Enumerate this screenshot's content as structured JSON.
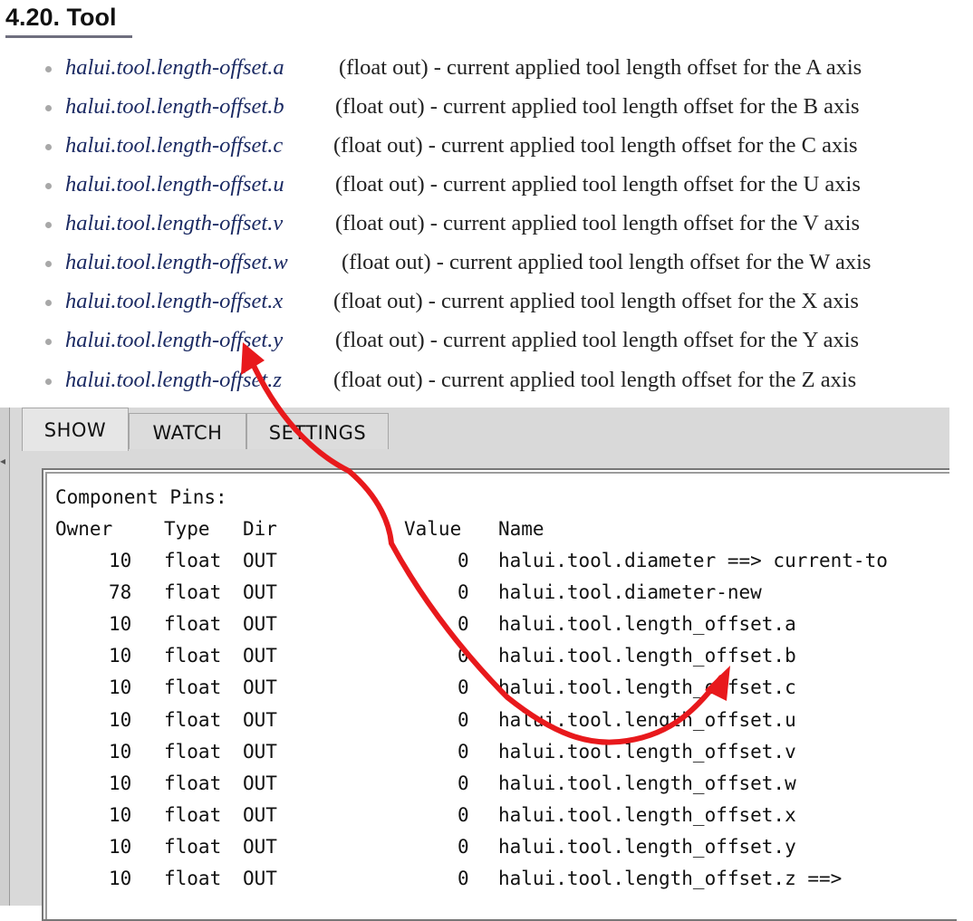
{
  "doc": {
    "title": "4.20. Tool",
    "pins": [
      {
        "name": "halui.tool.length-offset.a",
        "desc": "(float out) - current applied tool length offset for the A axis"
      },
      {
        "name": "halui.tool.length-offset.b",
        "desc": "(float out) - current applied tool length offset for the B axis"
      },
      {
        "name": "halui.tool.length-offset.c",
        "desc": "(float out) - current applied tool length offset for the C axis"
      },
      {
        "name": "halui.tool.length-offset.u",
        "desc": "(float out) - current applied tool length offset for the U axis"
      },
      {
        "name": "halui.tool.length-offset.v",
        "desc": "(float out) - current applied tool length offset for the V axis"
      },
      {
        "name": "halui.tool.length-offset.w",
        "desc": "(float out) - current applied tool length offset for the W axis"
      },
      {
        "name": "halui.tool.length-offset.x",
        "desc": "(float out) - current applied tool length offset for the X axis"
      },
      {
        "name": "halui.tool.length-offset.y",
        "desc": "(float out) - current applied tool length offset for the Y axis"
      },
      {
        "name": "halui.tool.length-offset.z",
        "desc": "(float out) - current applied tool length offset for the Z axis"
      }
    ]
  },
  "halshow": {
    "tabs": [
      {
        "label": "SHOW",
        "active": true
      },
      {
        "label": "WATCH",
        "active": false
      },
      {
        "label": "SETTINGS",
        "active": false
      }
    ],
    "section_title": "Component Pins:",
    "columns": {
      "owner": "Owner",
      "type": "Type",
      "dir": "Dir",
      "value": "Value",
      "name": "Name"
    },
    "rows": [
      {
        "owner": "10",
        "type": "float",
        "dir": "OUT",
        "value": "0",
        "name": "halui.tool.diameter ==> current-to"
      },
      {
        "owner": "78",
        "type": "float",
        "dir": "OUT",
        "value": "0",
        "name": "halui.tool.diameter-new"
      },
      {
        "owner": "10",
        "type": "float",
        "dir": "OUT",
        "value": "0",
        "name": "halui.tool.length_offset.a"
      },
      {
        "owner": "10",
        "type": "float",
        "dir": "OUT",
        "value": "0",
        "name": "halui.tool.length_offset.b"
      },
      {
        "owner": "10",
        "type": "float",
        "dir": "OUT",
        "value": "0",
        "name": "halui.tool.length_offset.c"
      },
      {
        "owner": "10",
        "type": "float",
        "dir": "OUT",
        "value": "0",
        "name": "halui.tool.length_offset.u"
      },
      {
        "owner": "10",
        "type": "float",
        "dir": "OUT",
        "value": "0",
        "name": "halui.tool.length_offset.v"
      },
      {
        "owner": "10",
        "type": "float",
        "dir": "OUT",
        "value": "0",
        "name": "halui.tool.length_offset.w"
      },
      {
        "owner": "10",
        "type": "float",
        "dir": "OUT",
        "value": "0",
        "name": "halui.tool.length_offset.x"
      },
      {
        "owner": "10",
        "type": "float",
        "dir": "OUT",
        "value": "0",
        "name": "halui.tool.length_offset.y"
      },
      {
        "owner": "10",
        "type": "float",
        "dir": "OUT",
        "value": "0",
        "name": "halui.tool.length_offset.z ==>"
      }
    ]
  },
  "annotation": {
    "color": "#e8191c",
    "icon": "double-headed-arrow-icon"
  },
  "colors": {
    "doc_link": "#1b2a63",
    "panel_bg": "#d9d9d9",
    "text": "#111111"
  }
}
